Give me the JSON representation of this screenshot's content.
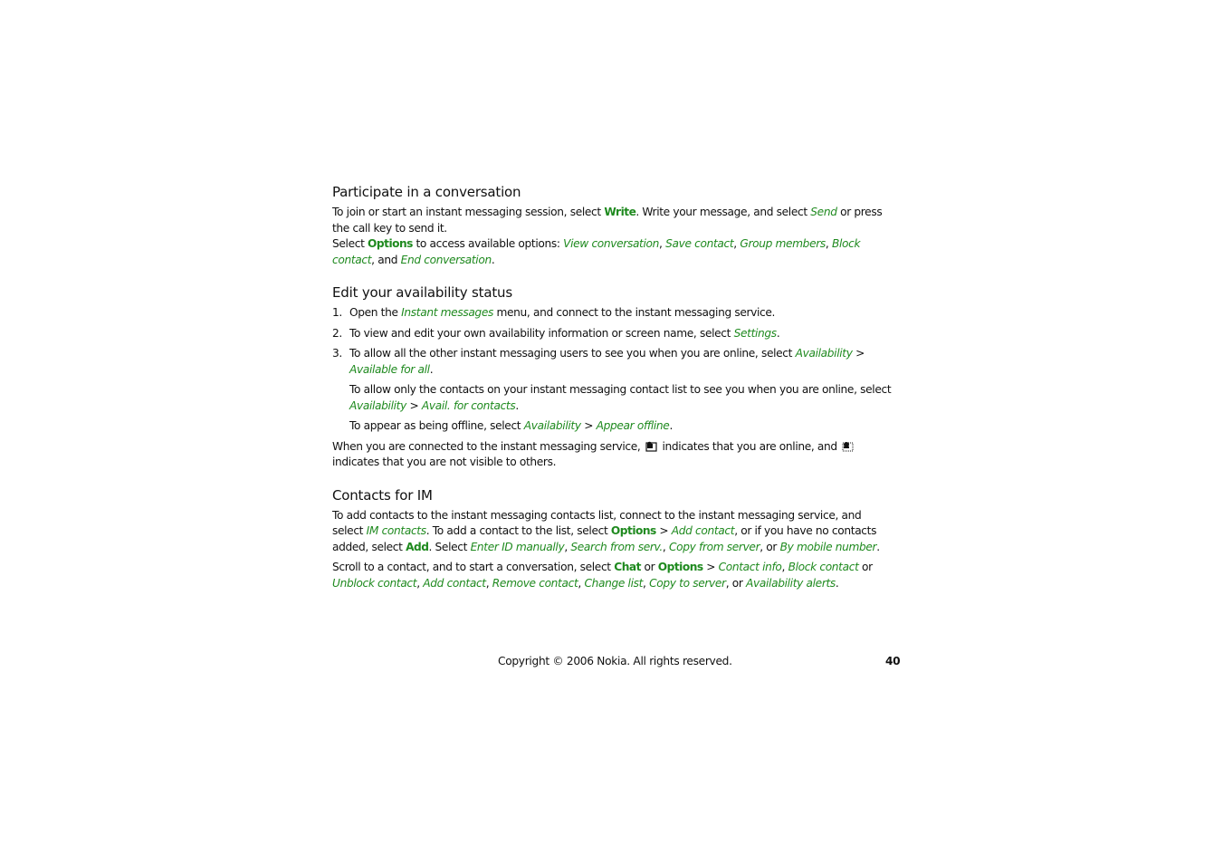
{
  "sections": [
    {
      "heading": "Participate in a conversation",
      "p1": {
        "t1": "To join or start an instant messaging session, select ",
        "write": "Write",
        "t2": ". Write your message, and select ",
        "send": "Send",
        "t3": " or press the call key to send it."
      },
      "p2": {
        "t1": "Select ",
        "options": "Options",
        "t2": " to access available options: ",
        "opt1": "View conversation",
        "sep1": ", ",
        "opt2": "Save contact",
        "sep2": ", ",
        "opt3": "Group members",
        "sep3": ", ",
        "opt4": "Block contact",
        "sep4": ", and ",
        "opt5": "End conversation",
        "end": "."
      }
    },
    {
      "heading": "Edit your availability status",
      "steps": [
        {
          "num": "1.",
          "t1": "Open the ",
          "link1": "Instant messages",
          "t2": " menu, and connect to the instant messaging service."
        },
        {
          "num": "2.",
          "t1": "To view and edit your own availability information or screen name, select ",
          "link1": "Settings",
          "t2": "."
        },
        {
          "num": "3.",
          "t1": "To allow all the other instant messaging users to see you when you are online, select ",
          "link1": "Availability",
          "sep": " > ",
          "link2": "Available for all",
          "t2": "."
        }
      ],
      "sub1": {
        "t1": "To allow only the contacts on your instant messaging contact list to see you when you are online, select ",
        "link1": "Availability",
        "sep": " > ",
        "link2": "Avail. for contacts",
        "t2": "."
      },
      "sub2": {
        "t1": "To appear as being offline, select ",
        "link1": "Availability",
        "sep": " > ",
        "link2": "Appear offline",
        "t2": "."
      },
      "status_note": {
        "t1": "When you are connected to the instant messaging service,",
        "icon1": "online-status-icon",
        "t2": "indicates that you are online, and",
        "icon2": "invisible-status-icon",
        "t3": "indicates that you are not visible to others."
      }
    },
    {
      "heading": "Contacts for IM",
      "p1": {
        "t1": "To add contacts to the instant messaging contacts list, connect to the instant messaging service, and select ",
        "link1": "IM contacts",
        "t2": ". To add a contact to the list, select ",
        "options": "Options",
        "sep": " > ",
        "link2": "Add contact",
        "t3": ", or if you have no contacts added, select ",
        "add": "Add",
        "t4": ". Select ",
        "opt1": "Enter ID manually",
        "sep1": ", ",
        "opt2": "Search from serv.",
        "sep2": ", ",
        "opt3": "Copy from server",
        "sep3": ", or ",
        "opt4": "By mobile number",
        "end": "."
      },
      "p2": {
        "t1": "Scroll to a contact, and to start a conversation, select ",
        "chat": "Chat",
        "or1": " or ",
        "options": "Options",
        "sep": " > ",
        "opt1": "Contact info",
        "sep1": ", ",
        "opt2": "Block contact",
        "or2": " or ",
        "opt3": "Unblock contact",
        "sep3": ", ",
        "opt4": "Add contact",
        "sep4": ", ",
        "opt5": "Remove contact",
        "sep5": ", ",
        "opt6": "Change list",
        "sep6": ", ",
        "opt7": "Copy to server",
        "sep7": ", or ",
        "opt8": "Availability alerts",
        "end": "."
      }
    }
  ],
  "footer": {
    "copyright": "Copyright © 2006 Nokia. All rights reserved.",
    "page_number": "40"
  },
  "colors": {
    "accent_green": "#1f8a1f",
    "text": "#111111"
  }
}
